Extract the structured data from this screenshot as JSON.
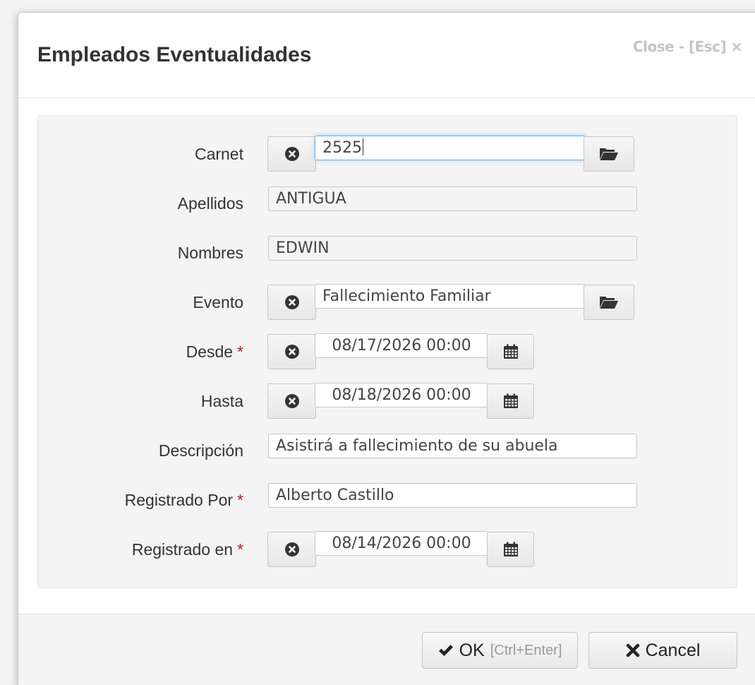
{
  "dialog": {
    "title": "Empleados Eventualidades",
    "close_label": "Close - [Esc] ×"
  },
  "form": {
    "carnet": {
      "label": "Carnet",
      "value": "2525"
    },
    "apellidos": {
      "label": "Apellidos",
      "value": "ANTIGUA"
    },
    "nombres": {
      "label": "Nombres",
      "value": "EDWIN"
    },
    "evento": {
      "label": "Evento",
      "value": "Fallecimiento Familiar"
    },
    "desde": {
      "label": "Desde",
      "required_mark": "*",
      "value": "08/17/2026 00:00"
    },
    "hasta": {
      "label": "Hasta",
      "value": "08/18/2026 00:00"
    },
    "descripcion": {
      "label": "Descripción",
      "value": "Asistirá a fallecimiento de su abuela"
    },
    "registrado_por": {
      "label": "Registrado Por",
      "required_mark": "*",
      "value": "Alberto Castillo"
    },
    "registrado_en": {
      "label": "Registrado en",
      "required_mark": "*",
      "value": "08/14/2026 00:00"
    }
  },
  "footer": {
    "ok_label": "OK",
    "ok_hint": "[Ctrl+Enter]",
    "cancel_label": "Cancel"
  },
  "icons": {
    "clear": "clear-circle-icon",
    "lookup": "folder-open-icon",
    "calendar": "calendar-icon",
    "ok": "checkmark-icon",
    "cancel": "x-icon"
  },
  "colors": {
    "required": "#dd1111",
    "focus_border": "#66afe9"
  }
}
